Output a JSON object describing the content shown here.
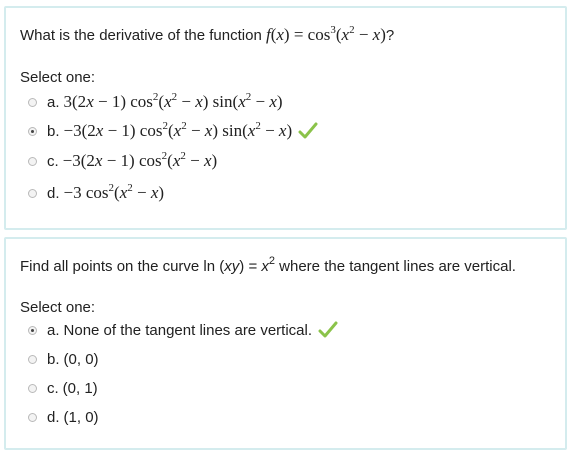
{
  "q1": {
    "prompt": "What is the derivative of the function ",
    "func": "f(x) = cos³(x² − x)",
    "suffix": "?",
    "select_label": "Select one:",
    "options": [
      {
        "letter": "a.",
        "text": "3(2x − 1) cos²(x² − x) sin(x² − x)",
        "selected": false,
        "correct": false
      },
      {
        "letter": "b.",
        "text": "−3(2x − 1) cos²(x² − x) sin(x² − x)",
        "selected": true,
        "correct": true
      },
      {
        "letter": "c.",
        "text": "−3(2x − 1) cos²(x² − x)",
        "selected": false,
        "correct": false
      },
      {
        "letter": "d.",
        "text": "−3 cos²(x² − x)",
        "selected": false,
        "correct": false
      }
    ]
  },
  "q2": {
    "prompt": "Find all points on the curve ln (xy) = x² where the tangent lines are vertical.",
    "select_label": "Select one:",
    "options": [
      {
        "letter": "a.",
        "text": "None of the tangent lines are vertical.",
        "selected": true,
        "correct": true
      },
      {
        "letter": "b.",
        "text": "(0, 0)",
        "selected": false,
        "correct": false
      },
      {
        "letter": "c.",
        "text": "(0, 1)",
        "selected": false,
        "correct": false
      },
      {
        "letter": "d.",
        "text": "(1, 0)",
        "selected": false,
        "correct": false
      }
    ]
  },
  "colors": {
    "card_border": "#d4ecee",
    "check": "#8bc34a",
    "text": "#212121"
  },
  "icons": {
    "correct": "check-icon",
    "radio": "radio-icon"
  }
}
